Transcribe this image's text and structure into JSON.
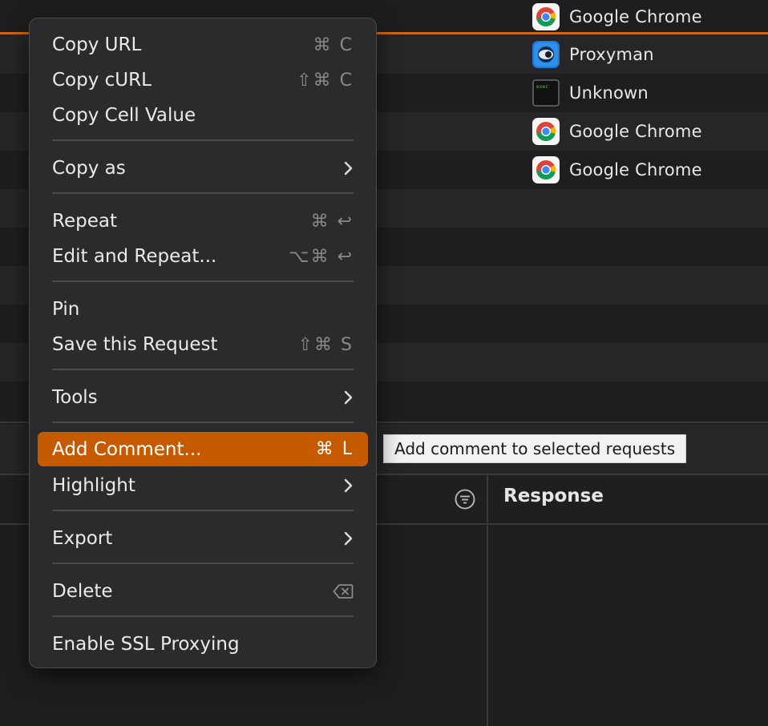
{
  "table": {
    "rows": [
      {
        "client": "Google Chrome",
        "icon": "chrome-icon"
      },
      {
        "client": "Proxyman",
        "icon": "proxyman-icon"
      },
      {
        "client": "Unknown",
        "icon": "terminal-exec-icon"
      },
      {
        "client": "Google Chrome",
        "icon": "chrome-icon"
      },
      {
        "client": "Google Chrome",
        "icon": "chrome-icon"
      }
    ]
  },
  "exec_icon_label": "exec",
  "response_panel": {
    "title": "Response"
  },
  "tooltip": {
    "text": "Add comment to selected requests"
  },
  "menu": {
    "copy_url": {
      "label": "Copy URL",
      "shortcut": "⌘ C"
    },
    "copy_curl": {
      "label": "Copy cURL",
      "shortcut": "⇧⌘ C"
    },
    "copy_cell_value": {
      "label": "Copy Cell Value"
    },
    "copy_as": {
      "label": "Copy as"
    },
    "repeat": {
      "label": "Repeat",
      "shortcut": "⌘ ↩"
    },
    "edit_and_repeat": {
      "label": "Edit and Repeat...",
      "shortcut": "⌥⌘ ↩"
    },
    "pin": {
      "label": "Pin"
    },
    "save_request": {
      "label": "Save this Request",
      "shortcut": "⇧⌘ S"
    },
    "tools": {
      "label": "Tools"
    },
    "add_comment": {
      "label": "Add Comment...",
      "shortcut": "⌘ L"
    },
    "highlight": {
      "label": "Highlight"
    },
    "export": {
      "label": "Export"
    },
    "delete": {
      "label": "Delete"
    },
    "enable_ssl": {
      "label": "Enable SSL Proxying"
    }
  },
  "colors": {
    "accent": "#c55a00",
    "selected_row_line": "#d0680f",
    "menu_bg": "#2b2b2d",
    "app_bg": "#1e1e20"
  }
}
